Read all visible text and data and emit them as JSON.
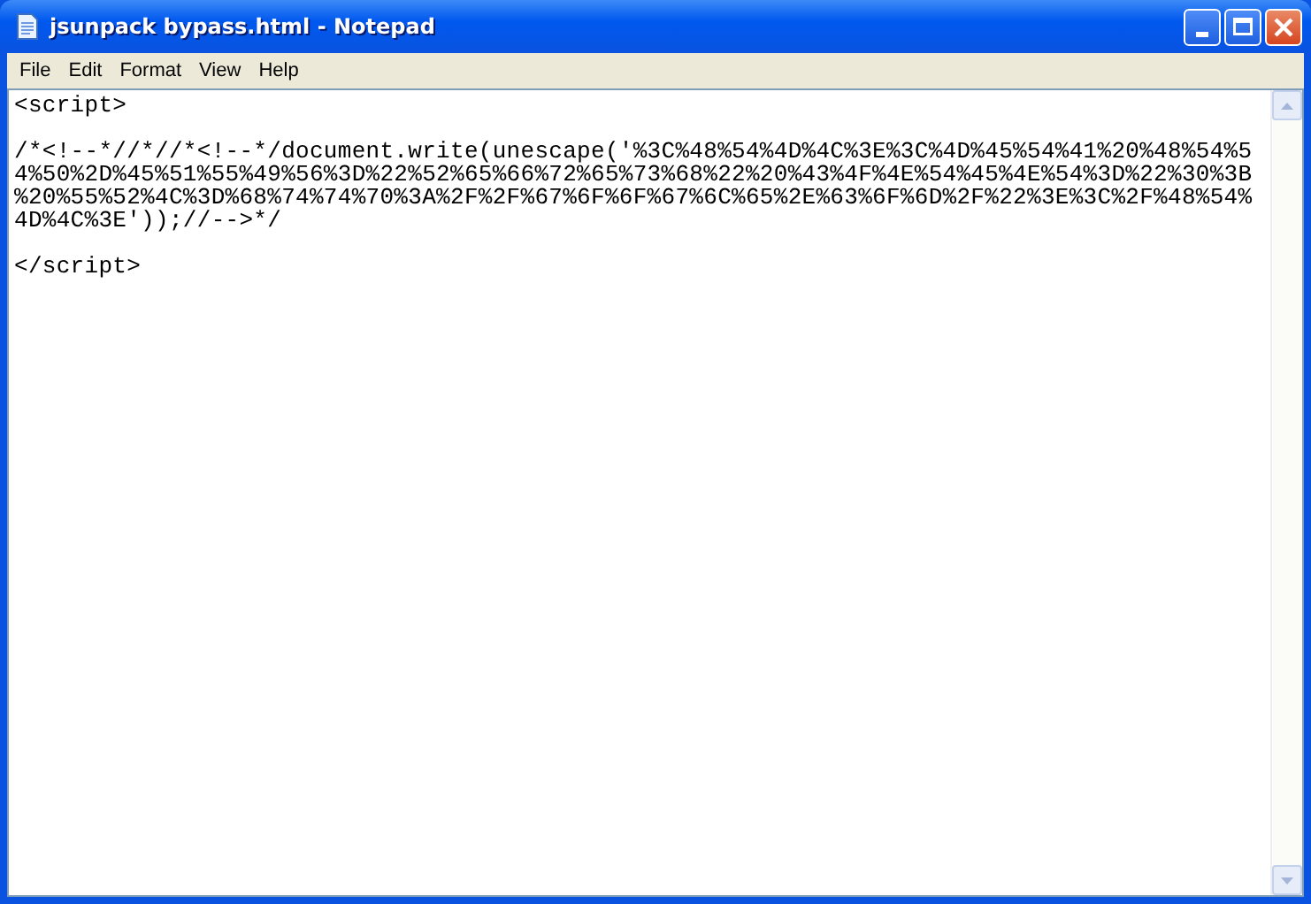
{
  "window": {
    "title": "jsunpack bypass.html - Notepad"
  },
  "menu": [
    "File",
    "Edit",
    "Format",
    "View",
    "Help"
  ],
  "editor": {
    "blocks": [
      [
        "<script>"
      ],
      [
        "/*<!--*//*//*<!--*/document.write(unescape('%3C%48%54%4D%4C%3E%3C%4D%45%54%41%20%48%54%5",
        "4%50%2D%45%51%55%49%56%3D%22%52%65%66%72%65%73%68%22%20%43%4F%4E%54%45%4E%54%3D%22%30%3B",
        "%20%55%52%4C%3D%68%74%74%70%3A%2F%2F%67%6F%6F%67%6C%65%2E%63%6F%6D%2F%22%3E%3C%2F%48%54%",
        "4D%4C%3E'));//-->*/"
      ],
      [
        "</script>"
      ]
    ]
  }
}
